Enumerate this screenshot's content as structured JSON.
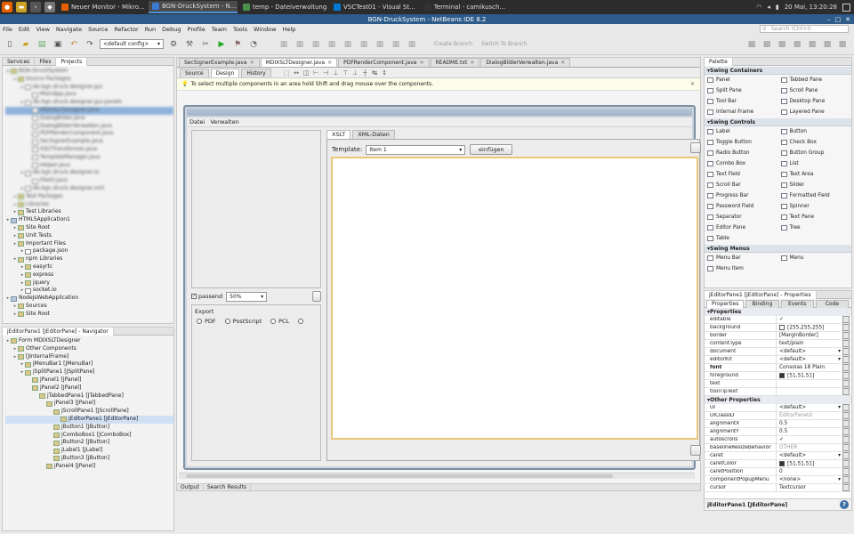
{
  "taskbar": {
    "tasks": [
      {
        "label": "Neuer Monitor - Mikro...",
        "color": "#e66000"
      },
      {
        "label": "BGN-DruckSystem - N...",
        "color": "#3a7bd5",
        "active": true
      },
      {
        "label": "temp - Dateiverwaltung",
        "color": "#4a8f4a"
      },
      {
        "label": "VSCTest01 - Visual St...",
        "color": "#0078d4"
      },
      {
        "label": "Terminal - camikusch...",
        "color": "#333333"
      }
    ],
    "clock": "20 Mai, 13:20:28"
  },
  "window": {
    "title": "BGN-DruckSystem - NetBeans IDE 8.2"
  },
  "menu": {
    "items": [
      "File",
      "Edit",
      "View",
      "Navigate",
      "Source",
      "Refactor",
      "Run",
      "Debug",
      "Profile",
      "Team",
      "Tools",
      "Window",
      "Help"
    ],
    "search_placeholder": "Search (Ctrl+I)"
  },
  "toolbar": {
    "config_value": "<default config>",
    "create_branch": "Create Branch",
    "switch_branch": "Switch To Branch"
  },
  "projects_panel": {
    "tabs": [
      "Services",
      "Files",
      "Projects"
    ],
    "tree": [
      {
        "label": "BGN-DruckSystem",
        "depth": 0,
        "blur": true
      },
      {
        "label": "Source Packages",
        "depth": 1,
        "blur": true
      },
      {
        "label": "de.bgn.druck.designer.gui",
        "depth": 2,
        "blur": true
      },
      {
        "label": "MainApp.java",
        "depth": 3,
        "blur": true
      },
      {
        "label": "de.bgn.druck.designer.gui.panels",
        "depth": 2,
        "blur": true
      },
      {
        "label": "MDIXSLTDesigner.java",
        "depth": 3,
        "blur": true,
        "selected": true
      },
      {
        "label": "DialogBilder.java",
        "depth": 3,
        "blur": true
      },
      {
        "label": "DialogBilderVerwalten.java",
        "depth": 3,
        "blur": true
      },
      {
        "label": "PDFRenderComponent.java",
        "depth": 3,
        "blur": true
      },
      {
        "label": "SecSignerExample.java",
        "depth": 3,
        "blur": true
      },
      {
        "label": "XSLTTransformer.java",
        "depth": 3,
        "blur": true
      },
      {
        "label": "TemplateManager.java",
        "depth": 3,
        "blur": true
      },
      {
        "label": "Helper.java",
        "depth": 3,
        "blur": true
      },
      {
        "label": "de.bgn.druck.designer.io",
        "depth": 2,
        "blur": true
      },
      {
        "label": "FileIO.java",
        "depth": 3,
        "blur": true
      },
      {
        "label": "de.bgn.druck.designer.xml",
        "depth": 2,
        "blur": true
      },
      {
        "label": "Test Packages",
        "depth": 1,
        "blur": true
      },
      {
        "label": "Libraries",
        "depth": 1,
        "blur": true
      },
      {
        "label": "Test Libraries",
        "depth": 1
      },
      {
        "label": "HTML5Application1",
        "depth": 0,
        "project": true
      },
      {
        "label": "Site Root",
        "depth": 1
      },
      {
        "label": "Unit Tests",
        "depth": 1
      },
      {
        "label": "Important Files",
        "depth": 1
      },
      {
        "label": "package.json",
        "depth": 2,
        "file": true
      },
      {
        "label": "npm Libraries",
        "depth": 1
      },
      {
        "label": "easyrtc",
        "depth": 2
      },
      {
        "label": "express",
        "depth": 2
      },
      {
        "label": "jquery",
        "depth": 2
      },
      {
        "label": "socket.io",
        "depth": 2
      },
      {
        "label": "NodeJsWebApplication",
        "depth": 0,
        "project": true
      },
      {
        "label": "Sources",
        "depth": 1
      },
      {
        "label": "Site Root",
        "depth": 1
      }
    ]
  },
  "navigator_panel": {
    "title": "jEditorPane1 [JEditorPane] - Navigator",
    "tree": [
      {
        "label": "Form MDIXSLTDesigner",
        "depth": 0
      },
      {
        "label": "Other Components",
        "depth": 1
      },
      {
        "label": "[JInternalFrame]",
        "depth": 1
      },
      {
        "label": "jMenuBar1 [JMenuBar]",
        "depth": 2
      },
      {
        "label": "jSplitPane1 [JSplitPane]",
        "depth": 2
      },
      {
        "label": "jPanel1 [JPanel]",
        "depth": 3
      },
      {
        "label": "jPanel2 [JPanel]",
        "depth": 3
      },
      {
        "label": "jTabbedPane1 [JTabbedPane]",
        "depth": 4
      },
      {
        "label": "jPanel3 [JPanel]",
        "depth": 5
      },
      {
        "label": "jScrollPane1 [JScrollPane]",
        "depth": 6
      },
      {
        "label": "jEditorPane1 [JEditorPane]",
        "depth": 7,
        "selected": true
      },
      {
        "label": "jButton1 [JButton]",
        "depth": 6
      },
      {
        "label": "jComboBox1 [JComboBox]",
        "depth": 6
      },
      {
        "label": "jButton2 [JButton]",
        "depth": 6
      },
      {
        "label": "jLabel1 [JLabel]",
        "depth": 6
      },
      {
        "label": "jButton3 [JButton]",
        "depth": 6
      },
      {
        "label": "jPanel4 [JPanel]",
        "depth": 5
      }
    ]
  },
  "editor": {
    "tabs": [
      "SecSignerExample.java",
      "MDIXSLTDesigner.java",
      "PDFRenderComponent.java",
      "README.txt",
      "DialogBilderVerwalten.java"
    ],
    "active_tab": 1,
    "view_tabs": [
      "Source",
      "Design",
      "History"
    ],
    "info": "To select multiple components in an area hold Shift and drag mouse over the components.",
    "form": {
      "menu": [
        "Datei",
        "Verwalten"
      ],
      "tabs": [
        "XSLT",
        "XML-Daten"
      ],
      "template_label": "Template:",
      "template_value": "Item 1",
      "insert_button": "einfügen",
      "passend_label": "passend",
      "zoom_value": "50%",
      "export_title": "Export",
      "export_options": [
        "PDF",
        "PostScript",
        "PCL"
      ]
    }
  },
  "bottom_tabs": [
    "Output",
    "Search Results"
  ],
  "palette": {
    "title": "Palette",
    "sections": [
      {
        "name": "Swing Containers",
        "items": [
          "Panel",
          "Tabbed Pane",
          "Split Pane",
          "Scroll Pane",
          "Tool Bar",
          "Desktop Pane",
          "Internal Frame",
          "Layered Pane"
        ]
      },
      {
        "name": "Swing Controls",
        "items": [
          "Label",
          "Button",
          "Toggle Button",
          "Check Box",
          "Radio Button",
          "Button Group",
          "Combo Box",
          "List",
          "Text Field",
          "Text Area",
          "Scroll Bar",
          "Slider",
          "Progress Bar",
          "Formatted Field",
          "Password Field",
          "Spinner",
          "Separator",
          "Text Pane",
          "Editor Pane",
          "Tree",
          "Table"
        ]
      },
      {
        "name": "Swing Menus",
        "items": [
          "Menu Bar",
          "Menu",
          "Menu Item"
        ]
      }
    ]
  },
  "properties": {
    "title": "jEditorPane1 [JEditorPane] - Properties",
    "tabs": [
      "Properties",
      "Binding",
      "Events",
      "Code"
    ],
    "sections": [
      {
        "name": "Properties",
        "rows": [
          {
            "key": "editable",
            "value": "✓"
          },
          {
            "key": "background",
            "value": "[255,255,255]",
            "swatch": "#ffffff"
          },
          {
            "key": "border",
            "value": "[MarginBorder]"
          },
          {
            "key": "contentType",
            "value": "text/plain"
          },
          {
            "key": "document",
            "value": "<default>"
          },
          {
            "key": "editorKit",
            "value": "<default>"
          },
          {
            "key": "font",
            "value": "Consolas 18 Plain",
            "bold": true
          },
          {
            "key": "foreground",
            "value": "[51,51,51]",
            "swatch": "#333333"
          },
          {
            "key": "text",
            "value": ""
          },
          {
            "key": "toolTipText",
            "value": ""
          }
        ]
      },
      {
        "name": "Other Properties",
        "rows": [
          {
            "key": "UI",
            "value": "<default>"
          },
          {
            "key": "UIClassID",
            "value": "EditorPaneUI",
            "gray": true
          },
          {
            "key": "alignmentX",
            "value": "0.5"
          },
          {
            "key": "alignmentY",
            "value": "0.5"
          },
          {
            "key": "autoscrolls",
            "value": "✓"
          },
          {
            "key": "baselineResizeBehavior",
            "value": "OTHER",
            "gray": true
          },
          {
            "key": "caret",
            "value": "<default>"
          },
          {
            "key": "caretColor",
            "value": "[51,51,51]",
            "swatch": "#333333"
          },
          {
            "key": "caretPosition",
            "value": "0"
          },
          {
            "key": "componentPopupMenu",
            "value": "<none>"
          },
          {
            "key": "cursor",
            "value": "Textcursor"
          }
        ]
      }
    ],
    "footer": "jEditorPane1 [JEditorPane]"
  }
}
